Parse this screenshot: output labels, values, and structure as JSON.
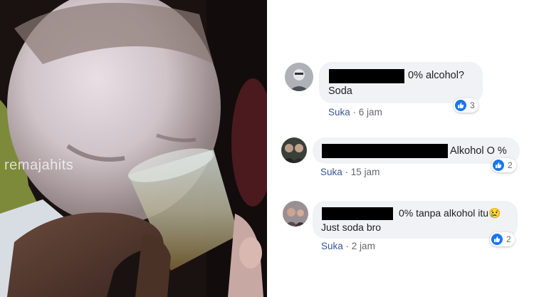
{
  "photo": {
    "watermark": "remajahits"
  },
  "comments": [
    {
      "text_line1": "0% alcohol?",
      "text_line2": "Soda",
      "like_label": "Suka",
      "separator": "·",
      "time": "6 jam",
      "reaction_count": "3"
    },
    {
      "text_line1": "Alkohol O %",
      "like_label": "Suka",
      "separator": "·",
      "time": "15 jam",
      "reaction_count": "2"
    },
    {
      "text_line1": "0% tanpa alkohol itu😢",
      "text_line2": "Just soda bro",
      "like_label": "Suka",
      "separator": "·",
      "time": "2 jam",
      "reaction_count": "2"
    }
  ],
  "colors": {
    "bubble": "#f0f2f5",
    "like_blue": "#1877f2",
    "meta_link": "#385898"
  }
}
